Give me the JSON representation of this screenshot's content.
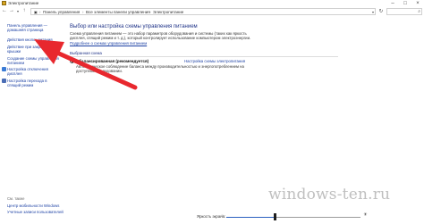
{
  "window": {
    "title": "Электропитание",
    "icon": "power-options-icon"
  },
  "address": {
    "crumbs": [
      "Панель управления",
      "Все элементы панели управления",
      "Электропитание"
    ],
    "separator": "›",
    "search_placeholder": ""
  },
  "sidebar": {
    "items": [
      {
        "label": "Панель управления —",
        "icon": ""
      },
      {
        "label": "домашняя страница",
        "icon": ""
      },
      {
        "label": "Действия кнопок питания",
        "icon": ""
      },
      {
        "label": "Действие при закрытии",
        "icon": ""
      },
      {
        "label": "крышки",
        "icon": ""
      },
      {
        "label": "Создание схемы управления",
        "icon": ""
      },
      {
        "label": "питанием",
        "icon": ""
      },
      {
        "label": "Настройка отключения",
        "icon": "shield-icon"
      },
      {
        "label": "дисплея",
        "icon": ""
      },
      {
        "label": "Настройка перехода в",
        "icon": "moon-icon"
      },
      {
        "label": "спящий режим",
        "icon": ""
      }
    ],
    "see_also_title": "См. также",
    "see_also": [
      "Центр мобильности Windows",
      "Учетные записи пользователей"
    ]
  },
  "main": {
    "heading": "Выбор или настройка схемы управления питанием",
    "description": "Схема управления питанием — это набор параметров оборудования и системы (таких как яркость дисплея, спящий режим и т. д.), который контролирует использование компьютером электроэнергии.",
    "desc_link": "Подробнее о схемах управления питанием",
    "section_label": "Выбранная схема",
    "plan_name": "Сбалансированная (рекомендуется)",
    "plan_settings_link": "Настройка схемы электропитания",
    "plan_description": "Автоматическое соблюдение баланса между производительностью и энергопотреблением на доступном оборудовании."
  },
  "footer": {
    "brightness_label": "Яркость экрана:",
    "brightness_level": 0.36
  },
  "watermark": "windows-ten.ru",
  "colors": {
    "link": "#1a3fa3",
    "heading": "#1e3287",
    "arrow": "#e8282e",
    "slider_fill": "#2a5fbf"
  }
}
